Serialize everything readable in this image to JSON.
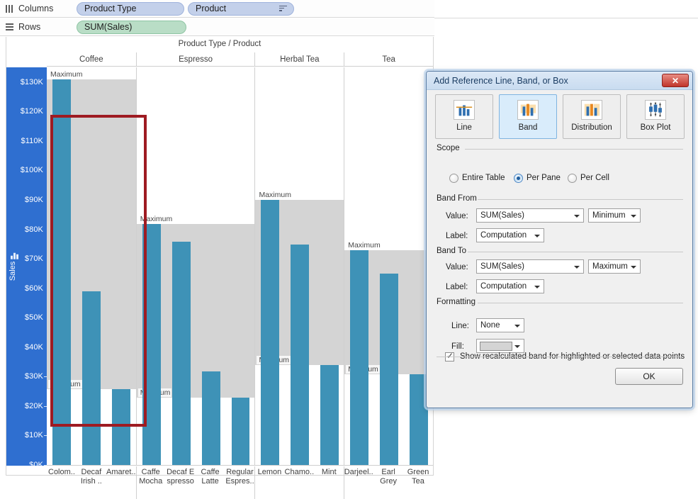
{
  "shelves": {
    "columns_label": "Columns",
    "rows_label": "Rows",
    "columns_pills": [
      "Product Type",
      "Product"
    ],
    "rows_pills": [
      "SUM(Sales)"
    ]
  },
  "viz": {
    "column_title": "Product Type / Product",
    "y_axis_title": "Sales",
    "band_min_label": "Minimum",
    "band_max_label": "Maximum"
  },
  "chart_data": {
    "type": "bar",
    "title": "Product Type / Product",
    "xlabel": "Product Type / Product",
    "ylabel": "Sales",
    "ylim": [
      0,
      135000
    ],
    "ytick_labels": [
      "$0K",
      "$10K",
      "$20K",
      "$30K",
      "$40K",
      "$50K",
      "$60K",
      "$70K",
      "$80K",
      "$90K",
      "$100K",
      "$110K",
      "$120K",
      "$130K"
    ],
    "ytick_values": [
      0,
      10000,
      20000,
      30000,
      40000,
      50000,
      60000,
      70000,
      80000,
      90000,
      100000,
      110000,
      120000,
      130000
    ],
    "grid": false,
    "legend": "none",
    "panes": [
      {
        "name": "Coffee",
        "categories": [
          "Colom..",
          "Decaf Irish ..",
          "Amaret.."
        ],
        "values": [
          131000,
          59000,
          26000
        ],
        "band_from": 26000,
        "band_to": 131000,
        "band_from_label": "Minimum",
        "band_to_label": "Maximum"
      },
      {
        "name": "Espresso",
        "categories": [
          "Caffe Mocha",
          "Decaf E spresso",
          "Caffe Latte",
          "Regular Espres.."
        ],
        "values": [
          82000,
          76000,
          32000,
          23000
        ],
        "band_from": 23000,
        "band_to": 82000,
        "band_from_label": "Minimum",
        "band_to_label": "Maximum"
      },
      {
        "name": "Herbal Tea",
        "categories": [
          "Lemon",
          "Chamo..",
          "Mint"
        ],
        "values": [
          90000,
          75000,
          34000
        ],
        "band_from": 34000,
        "band_to": 90000,
        "band_from_label": "Minimum",
        "band_to_label": "Maximum"
      },
      {
        "name": "Tea",
        "categories": [
          "Darjeel..",
          "Earl Grey",
          "Green Tea"
        ],
        "values": [
          73000,
          65000,
          31000
        ],
        "band_from": 31000,
        "band_to": 73000,
        "band_from_label": "Minimum",
        "band_to_label": "Maximum"
      }
    ]
  },
  "dialog": {
    "title": "Add Reference Line, Band, or Box",
    "close_label": "✕",
    "tabs": [
      {
        "label": "Line",
        "icon": "line-chart-icon",
        "selected": false
      },
      {
        "label": "Band",
        "icon": "band-chart-icon",
        "selected": true
      },
      {
        "label": "Distribution",
        "icon": "distribution-chart-icon",
        "selected": false
      },
      {
        "label": "Box Plot",
        "icon": "box-plot-icon",
        "selected": false
      }
    ],
    "scope": {
      "heading": "Scope",
      "options": [
        "Entire Table",
        "Per Pane",
        "Per Cell"
      ],
      "selected": "Per Pane"
    },
    "band_from": {
      "heading": "Band From",
      "value_label": "Value:",
      "value": "SUM(Sales)",
      "aggregation": "Minimum",
      "label_label": "Label:",
      "label_value": "Computation"
    },
    "band_to": {
      "heading": "Band To",
      "value_label": "Value:",
      "value": "SUM(Sales)",
      "aggregation": "Maximum",
      "label_label": "Label:",
      "label_value": "Computation"
    },
    "formatting": {
      "heading": "Formatting",
      "line_label": "Line:",
      "line_value": "None",
      "fill_label": "Fill:",
      "fill_color": "#d4d4d4"
    },
    "checkbox_label": "Show recalculated band for highlighted or selected data points",
    "checkbox_checked": true,
    "ok_label": "OK"
  },
  "colors": {
    "bar": "#3e92b7",
    "band": "#d4d4d4",
    "axis_highlight": "#2f6fd0",
    "selection": "#9e1b22",
    "pill_blue": "#c3d0ea",
    "pill_green": "#b9ddc6"
  }
}
